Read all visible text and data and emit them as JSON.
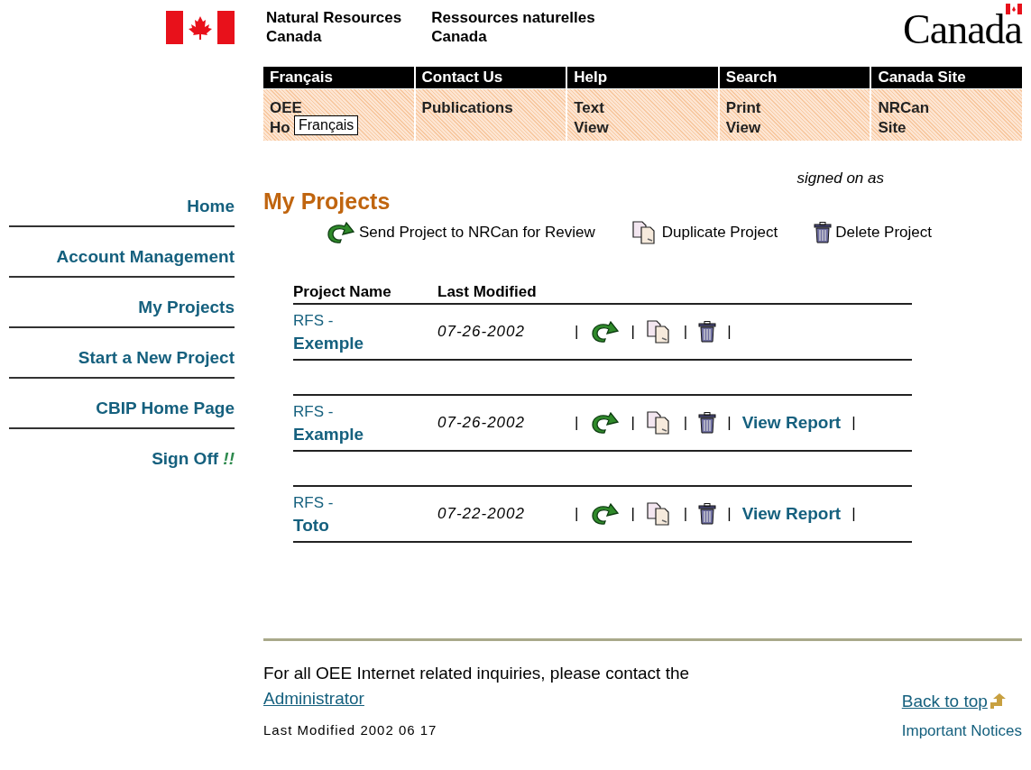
{
  "header": {
    "name_en": [
      "Natural Resources",
      "Canada"
    ],
    "name_fr": [
      "Ressources naturelles",
      "Canada"
    ],
    "wordmark": "Canada"
  },
  "nav": {
    "top": [
      "Français",
      "Contact Us",
      "Help",
      "Search",
      "Canada Site"
    ],
    "bottom": [
      {
        "lines": [
          "OEE",
          "Ho"
        ],
        "tooltip": "Français"
      },
      {
        "lines": [
          "Publications"
        ]
      },
      {
        "lines": [
          "Text",
          "View"
        ]
      },
      {
        "lines": [
          "Print",
          "View"
        ]
      },
      {
        "lines": [
          "NRCan",
          "Site"
        ]
      }
    ]
  },
  "signed_on": "signed on as",
  "sidebar": {
    "items": [
      {
        "label": "Home"
      },
      {
        "label": "Account Management"
      },
      {
        "label": "My Projects"
      },
      {
        "label": "Start a New Project"
      },
      {
        "label": "CBIP Home Page"
      },
      {
        "label": "Sign Off",
        "suffix": "!!"
      }
    ]
  },
  "page_title": "My Projects",
  "actions": [
    {
      "kind": "send",
      "label": "Send Project to NRCan for Review"
    },
    {
      "kind": "duplicate",
      "label": "Duplicate Project"
    },
    {
      "kind": "delete",
      "label": "Delete Project"
    }
  ],
  "table": {
    "columns": [
      "Project Name",
      "Last Modified"
    ],
    "separator": "|",
    "rows": [
      {
        "name_prefix": "RFS -",
        "name": "Exemple",
        "modified": "07-26-2002"
      },
      {
        "name_prefix": "RFS -",
        "name": "Example",
        "modified": "07-26-2002",
        "report_link": "View Report"
      },
      {
        "name_prefix": "RFS -",
        "name": "Toto",
        "modified": "07-22-2002",
        "report_link": "View Report"
      }
    ]
  },
  "footer": {
    "contact_text": "For all OEE Internet related inquiries, please contact the ",
    "contact_link": "Administrator",
    "back_to_top": "Back to top",
    "last_modified": "Last Modified 2002 06 17",
    "notices_link": "Important Notices"
  }
}
